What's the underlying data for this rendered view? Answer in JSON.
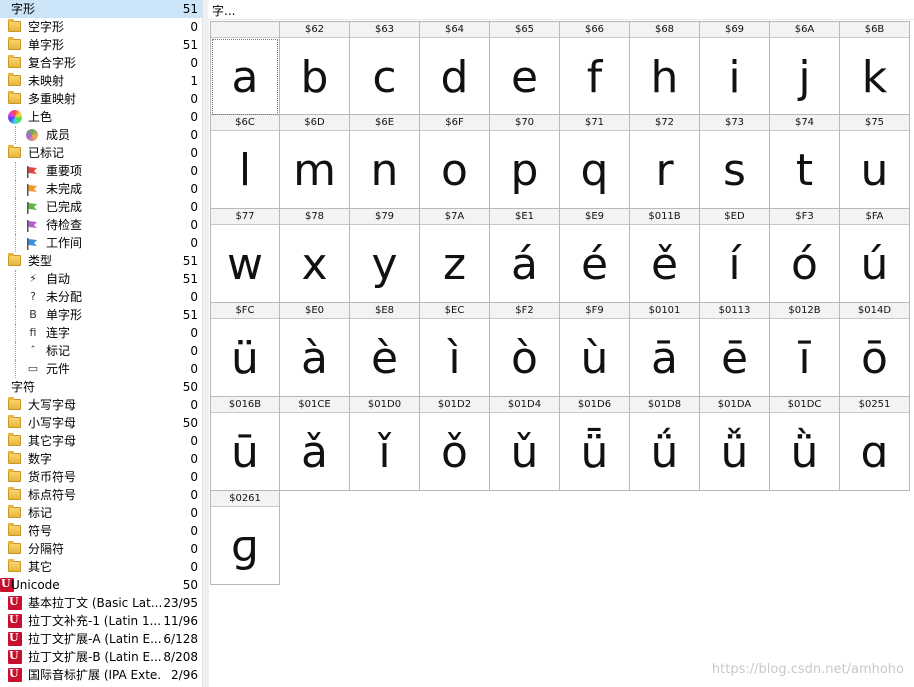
{
  "sidebar": {
    "rows": [
      {
        "label": "字形",
        "count": "51",
        "indent": 0,
        "icon": "glyph-root-icon",
        "sel": true
      },
      {
        "label": "空字形",
        "count": "0",
        "indent": 1,
        "icon": "folder-icon"
      },
      {
        "label": "单字形",
        "count": "51",
        "indent": 1,
        "icon": "folder-icon"
      },
      {
        "label": "复合字形",
        "count": "0",
        "indent": 1,
        "icon": "folder-icon"
      },
      {
        "label": "未映射",
        "count": "1",
        "indent": 1,
        "icon": "folder-icon"
      },
      {
        "label": "多重映射",
        "count": "0",
        "indent": 1,
        "icon": "folder-icon"
      },
      {
        "label": "上色",
        "count": "0",
        "indent": 1,
        "icon": "color-wheel-icon"
      },
      {
        "label": "成员",
        "count": "0",
        "indent": 2,
        "icon": "color-ball-icon"
      },
      {
        "label": "已标记",
        "count": "0",
        "indent": 1,
        "icon": "folder-icon"
      },
      {
        "label": "重要项",
        "count": "0",
        "indent": 2,
        "icon": "flag-red-icon"
      },
      {
        "label": "未完成",
        "count": "0",
        "indent": 2,
        "icon": "flag-orange-icon"
      },
      {
        "label": "已完成",
        "count": "0",
        "indent": 2,
        "icon": "flag-green-icon"
      },
      {
        "label": "待检查",
        "count": "0",
        "indent": 2,
        "icon": "flag-purple-icon"
      },
      {
        "label": "工作间",
        "count": "0",
        "indent": 2,
        "icon": "flag-blue-icon"
      },
      {
        "label": "类型",
        "count": "51",
        "indent": 1,
        "icon": "folder-icon"
      },
      {
        "label": "自动",
        "count": "51",
        "indent": 2,
        "icon": "lightning-icon",
        "glyph": "⚡"
      },
      {
        "label": "未分配",
        "count": "0",
        "indent": 2,
        "icon": "question-icon",
        "glyph": "?"
      },
      {
        "label": "单字形",
        "count": "51",
        "indent": 2,
        "icon": "letter-b-icon",
        "glyph": "B"
      },
      {
        "label": "连字",
        "count": "0",
        "indent": 2,
        "icon": "ligature-icon",
        "glyph": "ﬁ"
      },
      {
        "label": "标记",
        "count": "0",
        "indent": 2,
        "icon": "caret-icon",
        "glyph": "ˆ"
      },
      {
        "label": "元件",
        "count": "0",
        "indent": 2,
        "icon": "component-icon",
        "glyph": "▭"
      },
      {
        "label": "字符",
        "count": "50",
        "indent": 0,
        "icon": "char-root-icon"
      },
      {
        "label": "大写字母",
        "count": "0",
        "indent": 1,
        "icon": "folder-icon"
      },
      {
        "label": "小写字母",
        "count": "50",
        "indent": 1,
        "icon": "folder-icon"
      },
      {
        "label": "其它字母",
        "count": "0",
        "indent": 1,
        "icon": "folder-icon"
      },
      {
        "label": "数字",
        "count": "0",
        "indent": 1,
        "icon": "folder-icon"
      },
      {
        "label": "货币符号",
        "count": "0",
        "indent": 1,
        "icon": "folder-icon"
      },
      {
        "label": "标点符号",
        "count": "0",
        "indent": 1,
        "icon": "folder-icon"
      },
      {
        "label": "标记",
        "count": "0",
        "indent": 1,
        "icon": "folder-icon"
      },
      {
        "label": "符号",
        "count": "0",
        "indent": 1,
        "icon": "folder-icon"
      },
      {
        "label": "分隔符",
        "count": "0",
        "indent": 1,
        "icon": "folder-icon"
      },
      {
        "label": "其它",
        "count": "0",
        "indent": 1,
        "icon": "folder-icon"
      },
      {
        "label": "Unicode",
        "count": "50",
        "indent": 0,
        "icon": "unicode-root-icon"
      },
      {
        "label": "基本拉丁文 (Basic Lat...",
        "count": "23/95",
        "indent": 1,
        "icon": "unicode-icon"
      },
      {
        "label": "拉丁文补充-1 (Latin 1...",
        "count": "11/96",
        "indent": 1,
        "icon": "unicode-icon"
      },
      {
        "label": "拉丁文扩展-A (Latin E...",
        "count": "6/128",
        "indent": 1,
        "icon": "unicode-icon"
      },
      {
        "label": "拉丁文扩展-B (Latin E...",
        "count": "8/208",
        "indent": 1,
        "icon": "unicode-icon"
      },
      {
        "label": "国际音标扩展 (IPA Exte...",
        "count": "2/96",
        "indent": 1,
        "icon": "unicode-icon"
      }
    ]
  },
  "main": {
    "search_text": "字...",
    "cells": [
      {
        "code": "",
        "glyph": "a"
      },
      {
        "code": "$62",
        "glyph": "b"
      },
      {
        "code": "$63",
        "glyph": "c"
      },
      {
        "code": "$64",
        "glyph": "d"
      },
      {
        "code": "$65",
        "glyph": "e"
      },
      {
        "code": "$66",
        "glyph": "f"
      },
      {
        "code": "$68",
        "glyph": "h"
      },
      {
        "code": "$69",
        "glyph": "i"
      },
      {
        "code": "$6A",
        "glyph": "j"
      },
      {
        "code": "$6B",
        "glyph": "k"
      },
      {
        "code": "$6C",
        "glyph": "l"
      },
      {
        "code": "$6D",
        "glyph": "m"
      },
      {
        "code": "$6E",
        "glyph": "n"
      },
      {
        "code": "$6F",
        "glyph": "o"
      },
      {
        "code": "$70",
        "glyph": "p"
      },
      {
        "code": "$71",
        "glyph": "q"
      },
      {
        "code": "$72",
        "glyph": "r"
      },
      {
        "code": "$73",
        "glyph": "s"
      },
      {
        "code": "$74",
        "glyph": "t"
      },
      {
        "code": "$75",
        "glyph": "u"
      },
      {
        "code": "$77",
        "glyph": "w"
      },
      {
        "code": "$78",
        "glyph": "x"
      },
      {
        "code": "$79",
        "glyph": "y"
      },
      {
        "code": "$7A",
        "glyph": "z"
      },
      {
        "code": "$E1",
        "glyph": "á"
      },
      {
        "code": "$E9",
        "glyph": "é"
      },
      {
        "code": "$011B",
        "glyph": "ě"
      },
      {
        "code": "$ED",
        "glyph": "í"
      },
      {
        "code": "$F3",
        "glyph": "ó"
      },
      {
        "code": "$FA",
        "glyph": "ú"
      },
      {
        "code": "$FC",
        "glyph": "ü"
      },
      {
        "code": "$E0",
        "glyph": "à"
      },
      {
        "code": "$E8",
        "glyph": "è"
      },
      {
        "code": "$EC",
        "glyph": "ì"
      },
      {
        "code": "$F2",
        "glyph": "ò"
      },
      {
        "code": "$F9",
        "glyph": "ù"
      },
      {
        "code": "$0101",
        "glyph": "ā"
      },
      {
        "code": "$0113",
        "glyph": "ē"
      },
      {
        "code": "$012B",
        "glyph": "ī"
      },
      {
        "code": "$014D",
        "glyph": "ō"
      },
      {
        "code": "$016B",
        "glyph": "ū"
      },
      {
        "code": "$01CE",
        "glyph": "ǎ"
      },
      {
        "code": "$01D0",
        "glyph": "ǐ"
      },
      {
        "code": "$01D2",
        "glyph": "ǒ"
      },
      {
        "code": "$01D4",
        "glyph": "ǔ"
      },
      {
        "code": "$01D6",
        "glyph": "ǖ"
      },
      {
        "code": "$01D8",
        "glyph": "ǘ"
      },
      {
        "code": "$01DA",
        "glyph": "ǚ"
      },
      {
        "code": "$01DC",
        "glyph": "ǜ"
      },
      {
        "code": "$0251",
        "glyph": "ɑ"
      },
      {
        "code": "$0261",
        "glyph": "ɡ"
      }
    ]
  },
  "watermark": "https://blog.csdn.net/amhoho"
}
